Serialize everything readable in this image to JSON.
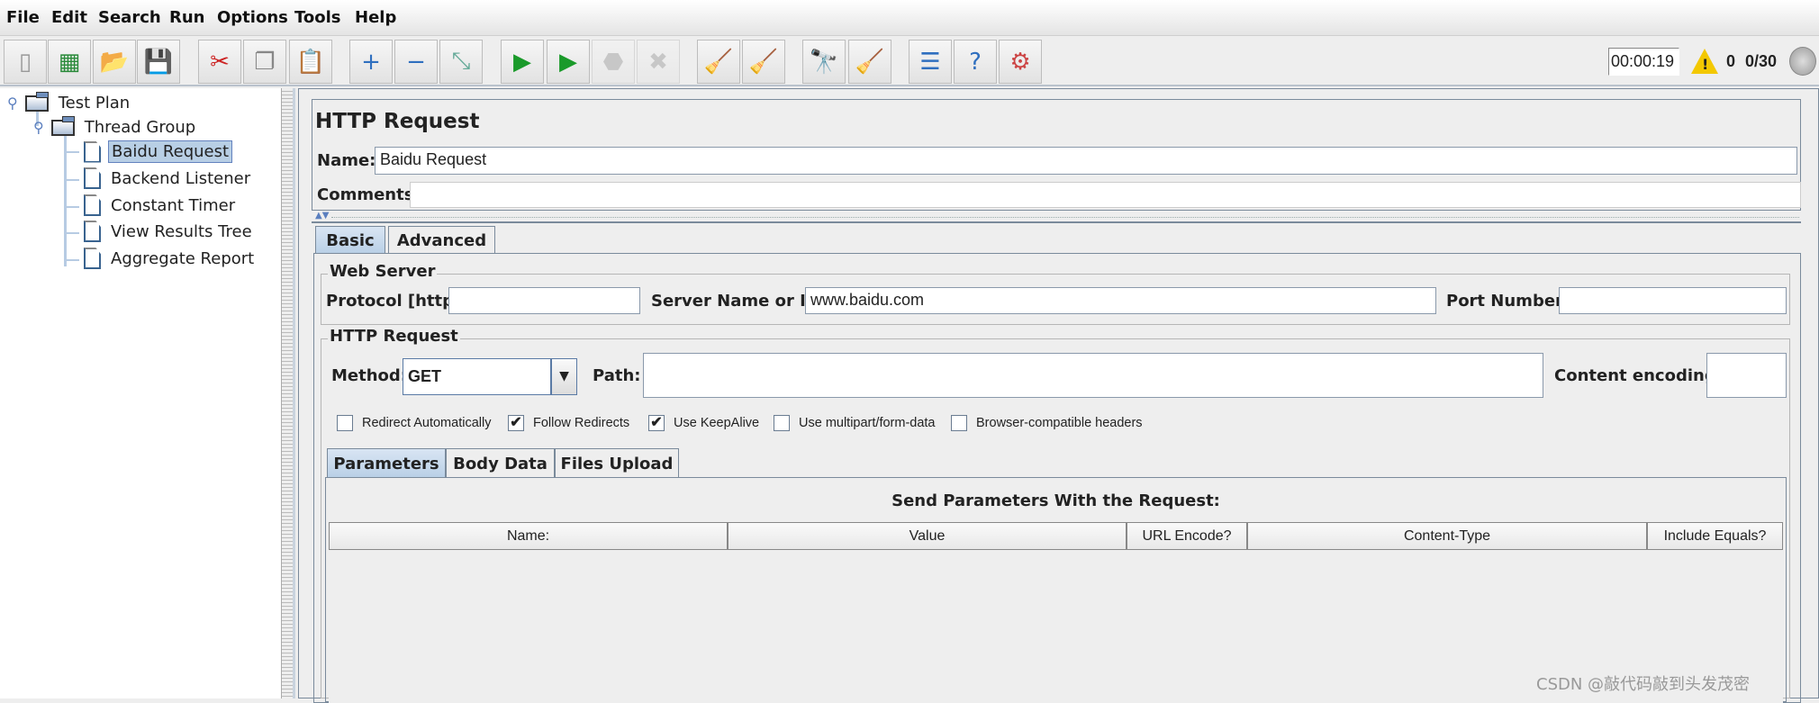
{
  "menu": [
    "File",
    "Edit",
    "Search",
    "Run",
    "Options",
    "Tools",
    "Help"
  ],
  "toolbar": {
    "buttons": [
      {
        "name": "new-icon",
        "glyph": "▯"
      },
      {
        "name": "templates-icon",
        "glyph": "▦"
      },
      {
        "name": "open-icon",
        "glyph": "📂"
      },
      {
        "name": "save-icon",
        "glyph": "💾"
      },
      {
        "name": "cut-icon",
        "glyph": "✂"
      },
      {
        "name": "copy-icon",
        "glyph": "❐"
      },
      {
        "name": "paste-icon",
        "glyph": "📋"
      },
      {
        "name": "expand-icon",
        "glyph": "+"
      },
      {
        "name": "collapse-icon",
        "glyph": "−"
      },
      {
        "name": "toggle-icon",
        "glyph": "⤡"
      },
      {
        "name": "start-icon",
        "glyph": "▶"
      },
      {
        "name": "start-no-pauses-icon",
        "glyph": "▶"
      },
      {
        "name": "stop-icon",
        "glyph": "⬣"
      },
      {
        "name": "shutdown-icon",
        "glyph": "✖"
      },
      {
        "name": "clear-icon",
        "glyph": "🧹"
      },
      {
        "name": "clear-all-icon",
        "glyph": "🧹"
      },
      {
        "name": "search-icon",
        "glyph": "🔭"
      },
      {
        "name": "reset-search-icon",
        "glyph": "🧹"
      },
      {
        "name": "function-helper-icon",
        "glyph": "☰"
      },
      {
        "name": "help-icon",
        "glyph": "?"
      },
      {
        "name": "remote-icon",
        "glyph": "⚙"
      }
    ],
    "timer": "00:00:19",
    "warning_count": "0",
    "threads": "0/30"
  },
  "tree": {
    "root": "Test Plan",
    "group": "Thread Group",
    "children": [
      "Baidu Request",
      "Backend Listener",
      "Constant Timer",
      "View Results Tree",
      "Aggregate Report"
    ],
    "selected": "Baidu Request"
  },
  "panel": {
    "title": "HTTP Request",
    "name_label": "Name:",
    "name_value": "Baidu Request",
    "comments_label": "Comments:",
    "comments_value": "",
    "tabs": [
      "Basic",
      "Advanced"
    ],
    "web_server": {
      "legend": "Web Server",
      "protocol_label": "Protocol [http]:",
      "protocol_value": "",
      "server_label": "Server Name or IP:",
      "server_value": "www.baidu.com",
      "port_label": "Port Number:",
      "port_value": ""
    },
    "http_request": {
      "legend": "HTTP Request",
      "method_label": "Method:",
      "method_value": "GET",
      "path_label": "Path:",
      "path_value": "",
      "encoding_label": "Content encoding:",
      "encoding_value": ""
    },
    "checkboxes": [
      {
        "label": "Redirect Automatically",
        "checked": false
      },
      {
        "label": "Follow Redirects",
        "checked": true
      },
      {
        "label": "Use KeepAlive",
        "checked": true
      },
      {
        "label": "Use multipart/form-data",
        "checked": false
      },
      {
        "label": "Browser-compatible headers",
        "checked": false
      }
    ],
    "inner_tabs": [
      "Parameters",
      "Body Data",
      "Files Upload"
    ],
    "params_title": "Send Parameters With the Request:",
    "columns": [
      "Name:",
      "Value",
      "URL Encode?",
      "Content-Type",
      "Include Equals?"
    ]
  },
  "watermark": "CSDN @敲代码敲到头发茂密"
}
